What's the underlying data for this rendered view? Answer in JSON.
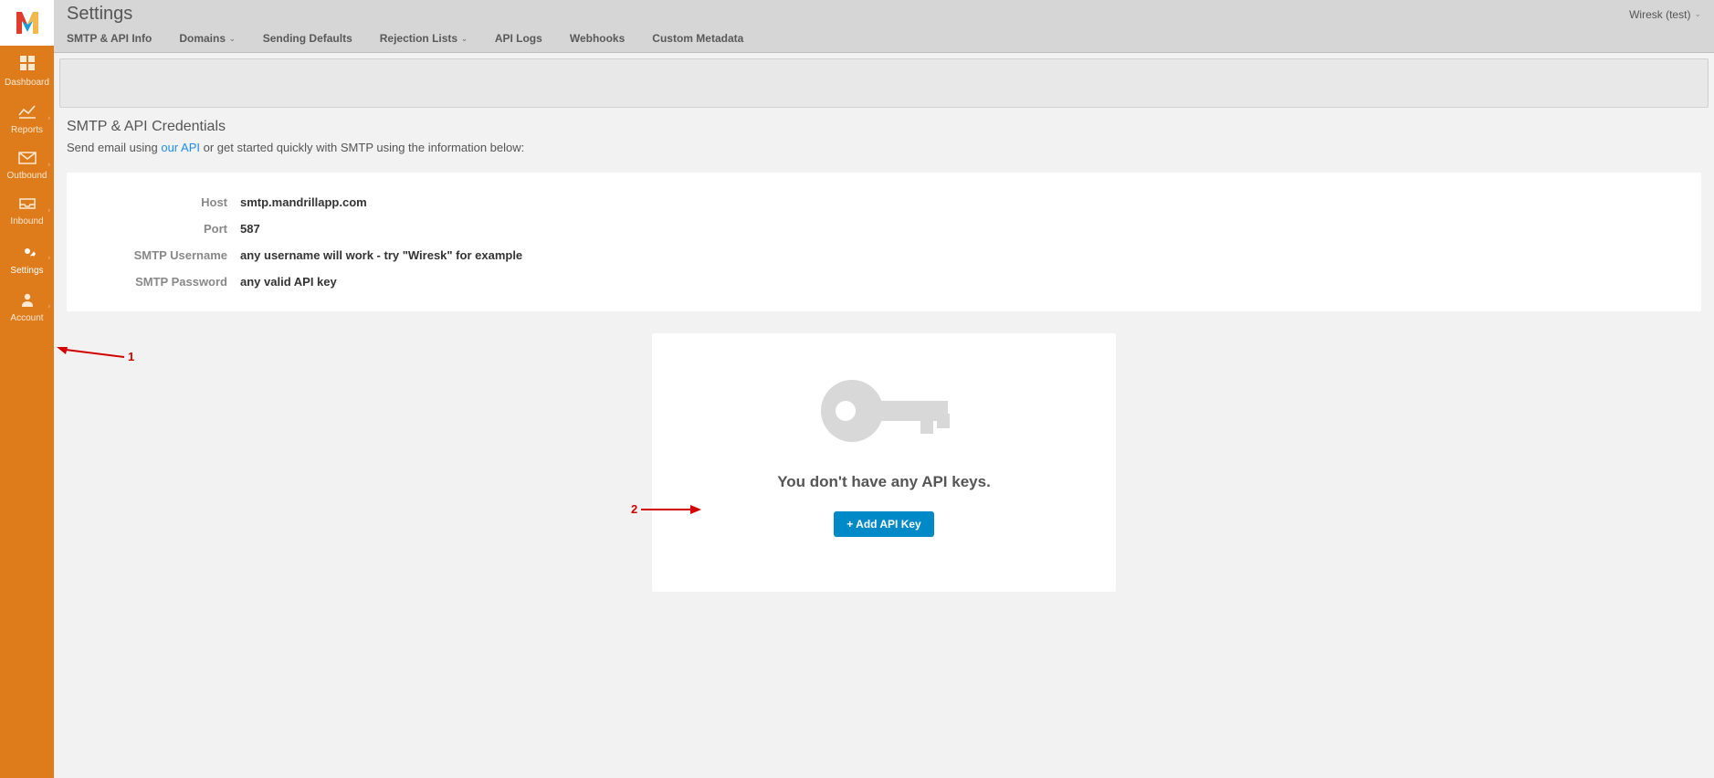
{
  "header": {
    "title": "Settings",
    "account_label": "Wiresk (test)"
  },
  "tabs": [
    {
      "label": "SMTP & API Info",
      "dropdown": false
    },
    {
      "label": "Domains",
      "dropdown": true
    },
    {
      "label": "Sending Defaults",
      "dropdown": false
    },
    {
      "label": "Rejection Lists",
      "dropdown": true
    },
    {
      "label": "API Logs",
      "dropdown": false
    },
    {
      "label": "Webhooks",
      "dropdown": false
    },
    {
      "label": "Custom Metadata",
      "dropdown": false
    }
  ],
  "sidebar": {
    "items": [
      {
        "label": "Dashboard"
      },
      {
        "label": "Reports"
      },
      {
        "label": "Outbound"
      },
      {
        "label": "Inbound"
      },
      {
        "label": "Settings"
      },
      {
        "label": "Account"
      }
    ]
  },
  "section": {
    "title": "SMTP & API Credentials",
    "sub_pre": "Send email using ",
    "sub_link": "our API",
    "sub_post": " or get started quickly with SMTP using the information below:"
  },
  "credentials": {
    "rows": [
      {
        "label": "Host",
        "value": "smtp.mandrillapp.com"
      },
      {
        "label": "Port",
        "value": "587"
      },
      {
        "label": "SMTP Username",
        "value": "any username will work - try \"Wiresk\" for example"
      },
      {
        "label": "SMTP Password",
        "value": "any valid API key"
      }
    ]
  },
  "empty": {
    "title": "You don't have any API keys.",
    "button": "+ Add API Key"
  },
  "annotations": {
    "n1": "1",
    "n2": "2"
  }
}
